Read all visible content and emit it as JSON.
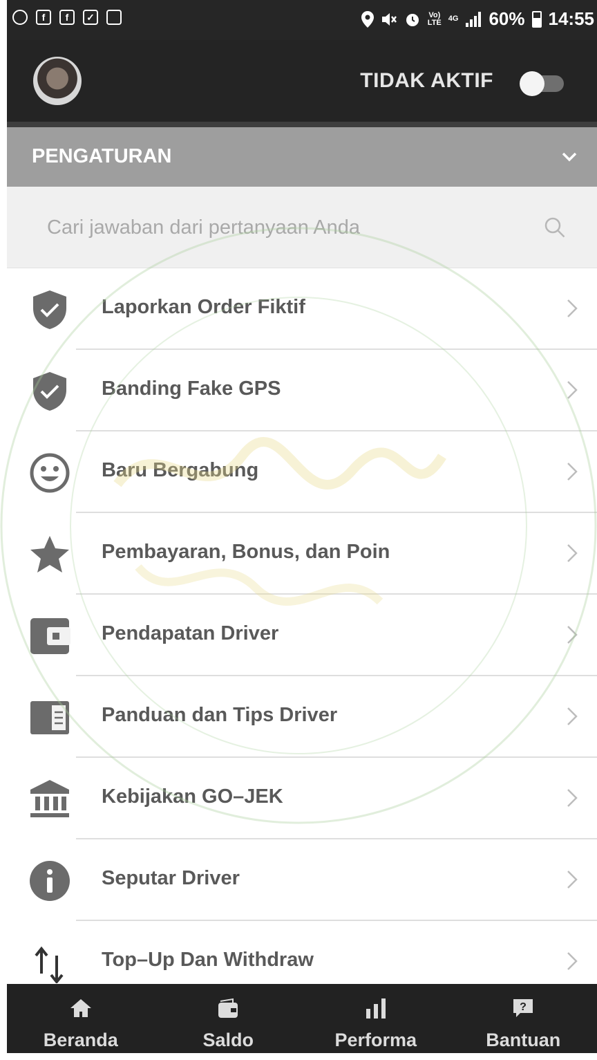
{
  "status_bar": {
    "battery_percent": "60%",
    "time": "14:55",
    "network": "4G",
    "volte": "Vo)\nLTE"
  },
  "header": {
    "driver_status": "TIDAK AKTIF",
    "toggle_on": false
  },
  "section": {
    "title": "PENGATURAN"
  },
  "search": {
    "placeholder": "Cari jawaban dari pertanyaan Anda"
  },
  "menu": {
    "items": [
      {
        "label": "Laporkan Order Fiktif",
        "icon": "shield-check-icon"
      },
      {
        "label": "Banding Fake GPS",
        "icon": "shield-check-icon"
      },
      {
        "label": "Baru Bergabung",
        "icon": "smiley-icon"
      },
      {
        "label": "Pembayaran, Bonus, dan Poin",
        "icon": "star-icon"
      },
      {
        "label": "Pendapatan Driver",
        "icon": "wallet-icon"
      },
      {
        "label": "Panduan dan Tips Driver",
        "icon": "guide-book-icon"
      },
      {
        "label": "Kebijakan GO–JEK",
        "icon": "bank-icon"
      },
      {
        "label": "Seputar Driver",
        "icon": "info-icon"
      },
      {
        "label": "Top–Up Dan Withdraw",
        "icon": "transfer-arrows-icon"
      }
    ]
  },
  "bottom_nav": {
    "items": [
      {
        "label": "Beranda",
        "icon": "home-icon"
      },
      {
        "label": "Saldo",
        "icon": "wallet-icon"
      },
      {
        "label": "Performa",
        "icon": "bar-chart-icon"
      },
      {
        "label": "Bantuan",
        "icon": "help-bubble-icon"
      }
    ]
  },
  "colors": {
    "header_bg": "#242424",
    "section_bg": "#9e9e9e",
    "icon_gray": "#6b6b6b",
    "watermark": "#a8cf9a"
  }
}
